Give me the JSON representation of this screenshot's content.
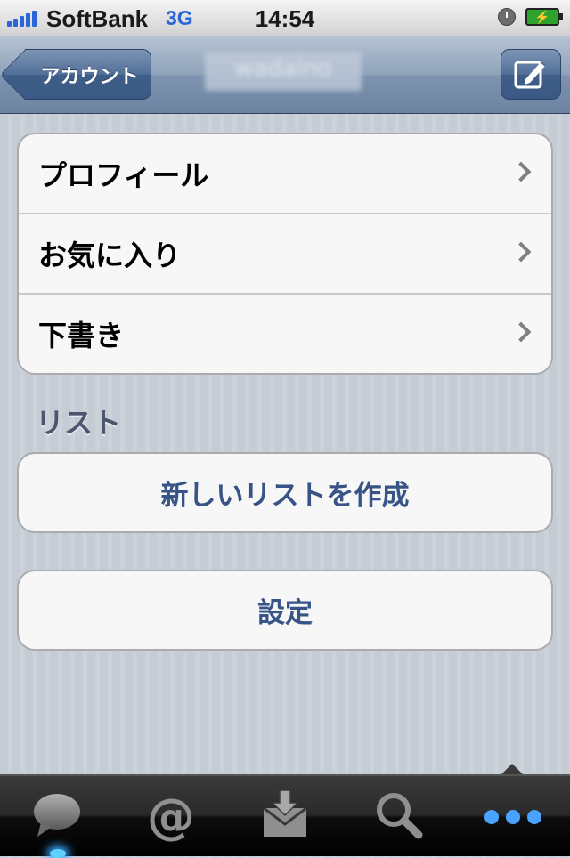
{
  "status_bar": {
    "carrier": "SoftBank",
    "network": "3G",
    "time": "14:54"
  },
  "nav": {
    "back_label": "アカウント",
    "title": "wadaino"
  },
  "menu": {
    "items": [
      {
        "label": "プロフィール"
      },
      {
        "label": "お気に入り"
      },
      {
        "label": "下書き"
      }
    ]
  },
  "list_section": {
    "header": "リスト",
    "create_label": "新しいリストを作成"
  },
  "settings": {
    "label": "設定"
  },
  "tab_bar": {
    "tabs": [
      {
        "icon": "speech-bubble-icon"
      },
      {
        "icon": "at-sign-icon"
      },
      {
        "icon": "inbox-icon"
      },
      {
        "icon": "magnifier-icon"
      },
      {
        "icon": "more-dots-icon",
        "selected": true
      }
    ]
  },
  "colors": {
    "nav_bar": "#7d93af",
    "button_text": "#385487",
    "background": "#c5ccd4",
    "network_blue": "#2b66d9",
    "tab_active": "#4aa3ff"
  }
}
